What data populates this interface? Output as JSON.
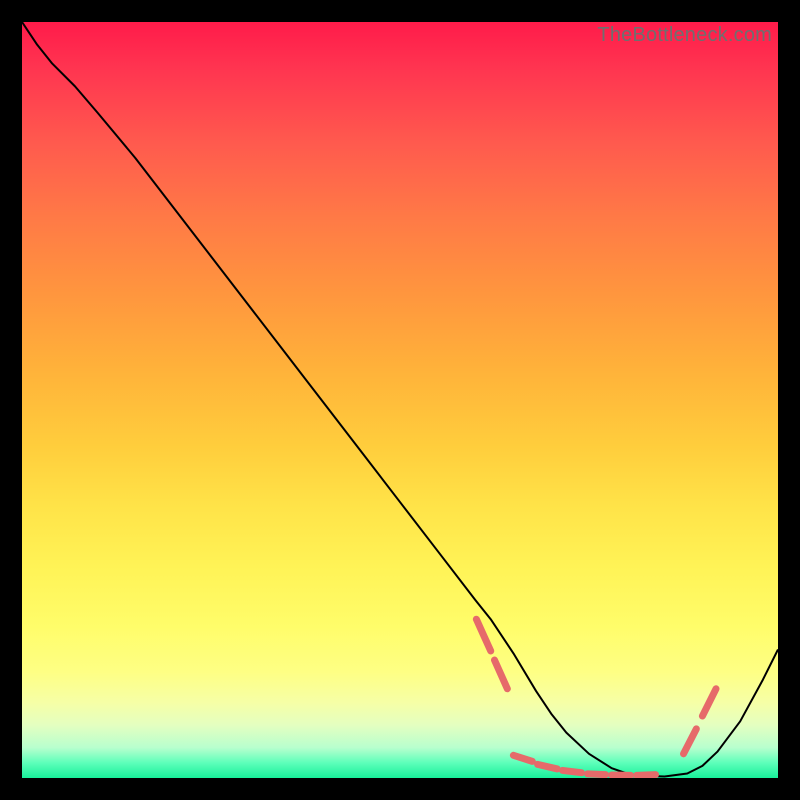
{
  "watermark": "TheBottleneck.com",
  "colors": {
    "dash": "#e66a6a",
    "curve": "#000000",
    "background": "#000000"
  },
  "chart_data": {
    "type": "line",
    "title": "",
    "xlabel": "",
    "ylabel": "",
    "xlim": [
      0,
      100
    ],
    "ylim": [
      0,
      100
    ],
    "grid": false,
    "legend": false,
    "series": [
      {
        "name": "bottleneck-curve",
        "x": [
          0,
          2,
          4,
          7,
          10,
          15,
          20,
          25,
          30,
          35,
          40,
          45,
          50,
          55,
          60,
          62,
          65,
          68,
          70,
          72,
          75,
          78,
          80,
          82,
          85,
          88,
          90,
          92,
          95,
          98,
          100
        ],
        "y": [
          100,
          97,
          94.5,
          91.5,
          88,
          82,
          75.5,
          69,
          62.5,
          56,
          49.5,
          43,
          36.5,
          30,
          23.5,
          21,
          16.5,
          11.5,
          8.5,
          6,
          3.2,
          1.3,
          0.6,
          0.3,
          0.2,
          0.6,
          1.6,
          3.5,
          7.5,
          13,
          17
        ]
      }
    ],
    "highlight_dashes": [
      {
        "x0": 60.1,
        "y0": 21.0,
        "x1": 62.0,
        "y1": 16.8
      },
      {
        "x0": 62.5,
        "y0": 15.6,
        "x1": 64.2,
        "y1": 11.8
      },
      {
        "x0": 65.0,
        "y0": 3.0,
        "x1": 67.5,
        "y1": 2.2
      },
      {
        "x0": 68.2,
        "y0": 1.8,
        "x1": 70.8,
        "y1": 1.2
      },
      {
        "x0": 71.5,
        "y0": 1.0,
        "x1": 74.0,
        "y1": 0.7
      },
      {
        "x0": 74.8,
        "y0": 0.55,
        "x1": 77.2,
        "y1": 0.45
      },
      {
        "x0": 78.0,
        "y0": 0.4,
        "x1": 80.5,
        "y1": 0.35
      },
      {
        "x0": 81.3,
        "y0": 0.35,
        "x1": 83.8,
        "y1": 0.45
      },
      {
        "x0": 87.5,
        "y0": 3.2,
        "x1": 89.2,
        "y1": 6.5
      },
      {
        "x0": 90.0,
        "y0": 8.2,
        "x1": 91.8,
        "y1": 11.8
      }
    ]
  }
}
